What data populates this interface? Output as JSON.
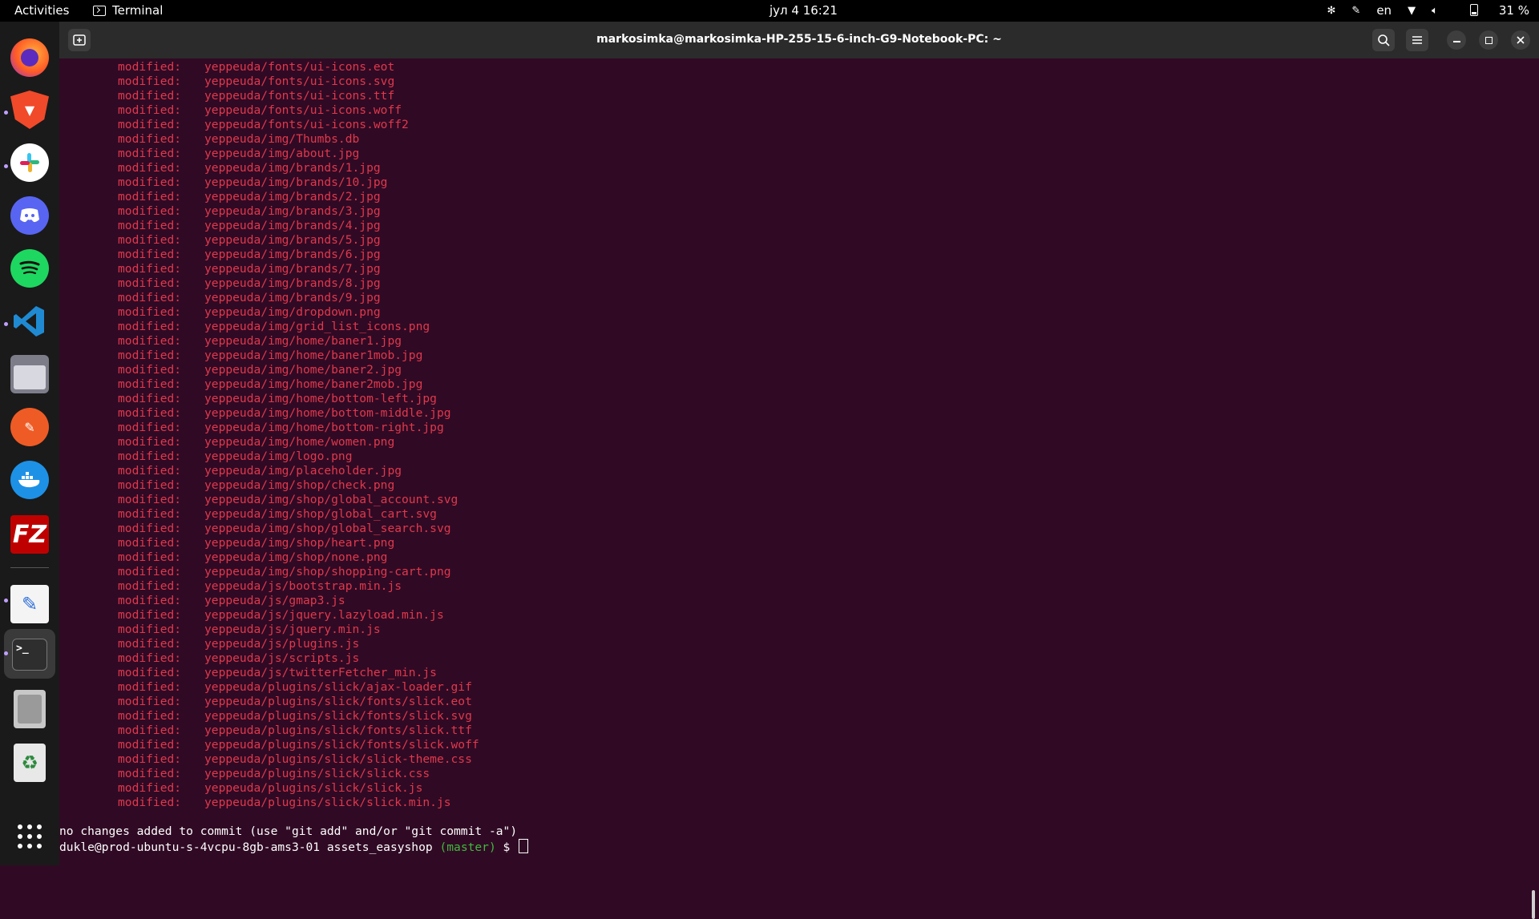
{
  "topbar": {
    "activities": "Activities",
    "app_name": "Terminal",
    "clock": "јул 4  16:21",
    "language": "en",
    "battery": "31 %"
  },
  "window": {
    "title": "markosimka@markosimka-HP-255-15-6-inch-G9-Notebook-PC: ~"
  },
  "dock": {
    "icons": [
      "firefox-icon",
      "brave-icon",
      "slack-icon",
      "discord-icon",
      "spotify-icon",
      "vscode-icon",
      "files-icon",
      "postman-icon",
      "docker-icon",
      "filezilla-icon",
      "text-editor-icon",
      "terminal-icon",
      "disks-icon",
      "trash-icon",
      "app-grid-icon"
    ]
  },
  "terminal": {
    "status_keyword": "modified:",
    "modified_files": [
      "yeppeuda/fonts/ui-icons.eot",
      "yeppeuda/fonts/ui-icons.svg",
      "yeppeuda/fonts/ui-icons.ttf",
      "yeppeuda/fonts/ui-icons.woff",
      "yeppeuda/fonts/ui-icons.woff2",
      "yeppeuda/img/Thumbs.db",
      "yeppeuda/img/about.jpg",
      "yeppeuda/img/brands/1.jpg",
      "yeppeuda/img/brands/10.jpg",
      "yeppeuda/img/brands/2.jpg",
      "yeppeuda/img/brands/3.jpg",
      "yeppeuda/img/brands/4.jpg",
      "yeppeuda/img/brands/5.jpg",
      "yeppeuda/img/brands/6.jpg",
      "yeppeuda/img/brands/7.jpg",
      "yeppeuda/img/brands/8.jpg",
      "yeppeuda/img/brands/9.jpg",
      "yeppeuda/img/dropdown.png",
      "yeppeuda/img/grid_list_icons.png",
      "yeppeuda/img/home/baner1.jpg",
      "yeppeuda/img/home/baner1mob.jpg",
      "yeppeuda/img/home/baner2.jpg",
      "yeppeuda/img/home/baner2mob.jpg",
      "yeppeuda/img/home/bottom-left.jpg",
      "yeppeuda/img/home/bottom-middle.jpg",
      "yeppeuda/img/home/bottom-right.jpg",
      "yeppeuda/img/home/women.png",
      "yeppeuda/img/logo.png",
      "yeppeuda/img/placeholder.jpg",
      "yeppeuda/img/shop/check.png",
      "yeppeuda/img/shop/global_account.svg",
      "yeppeuda/img/shop/global_cart.svg",
      "yeppeuda/img/shop/global_search.svg",
      "yeppeuda/img/shop/heart.png",
      "yeppeuda/img/shop/none.png",
      "yeppeuda/img/shop/shopping-cart.png",
      "yeppeuda/js/bootstrap.min.js",
      "yeppeuda/js/gmap3.js",
      "yeppeuda/js/jquery.lazyload.min.js",
      "yeppeuda/js/jquery.min.js",
      "yeppeuda/js/plugins.js",
      "yeppeuda/js/scripts.js",
      "yeppeuda/js/twitterFetcher_min.js",
      "yeppeuda/plugins/slick/ajax-loader.gif",
      "yeppeuda/plugins/slick/fonts/slick.eot",
      "yeppeuda/plugins/slick/fonts/slick.svg",
      "yeppeuda/plugins/slick/fonts/slick.ttf",
      "yeppeuda/plugins/slick/fonts/slick.woff",
      "yeppeuda/plugins/slick/slick-theme.css",
      "yeppeuda/plugins/slick/slick.css",
      "yeppeuda/plugins/slick/slick.js",
      "yeppeuda/plugins/slick/slick.min.js"
    ],
    "footer_message": "no changes added to commit (use \"git add\" and/or \"git commit -a\")",
    "prompt_host": "dukle@prod-ubuntu-s-4vcpu-8gb-ams3-01 assets_easyshop ",
    "prompt_branch": "(master)",
    "prompt_symbol": " $ "
  }
}
